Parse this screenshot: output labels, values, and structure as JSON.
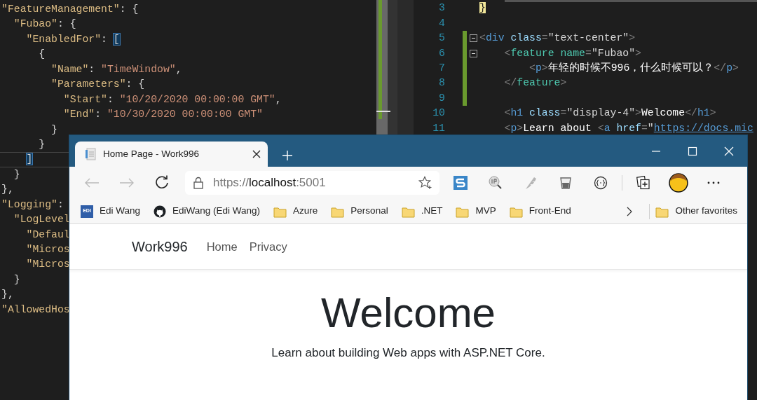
{
  "json_editor": {
    "lines": [
      {
        "current": false,
        "tokens": [
          {
            "text": "\"FeatureManagement\"",
            "kind": "k"
          },
          {
            "text": ": {",
            "kind": "p"
          }
        ]
      },
      {
        "current": false,
        "tokens": [
          {
            "text": "  \"Fubao\"",
            "kind": "k"
          },
          {
            "text": ": {",
            "kind": "p"
          }
        ]
      },
      {
        "current": false,
        "tokens": [
          {
            "text": "    \"EnabledFor\"",
            "kind": "k"
          },
          {
            "text": ": ",
            "kind": "p"
          },
          {
            "text": "[",
            "kind": "b"
          }
        ]
      },
      {
        "current": false,
        "tokens": [
          {
            "text": "      {",
            "kind": "p"
          }
        ]
      },
      {
        "current": false,
        "tokens": [
          {
            "text": "        \"Name\"",
            "kind": "k"
          },
          {
            "text": ": ",
            "kind": "p"
          },
          {
            "text": "\"TimeWindow\"",
            "kind": "s"
          },
          {
            "text": ",",
            "kind": "p"
          }
        ]
      },
      {
        "current": false,
        "tokens": [
          {
            "text": "        \"Parameters\"",
            "kind": "k"
          },
          {
            "text": ": {",
            "kind": "p"
          }
        ]
      },
      {
        "current": false,
        "tokens": [
          {
            "text": "          \"Start\"",
            "kind": "k"
          },
          {
            "text": ": ",
            "kind": "p"
          },
          {
            "text": "\"10/20/2020 00:00:00 GMT\"",
            "kind": "s"
          },
          {
            "text": ",",
            "kind": "p"
          }
        ]
      },
      {
        "current": false,
        "tokens": [
          {
            "text": "          \"End\"",
            "kind": "k"
          },
          {
            "text": ": ",
            "kind": "p"
          },
          {
            "text": "\"10/30/2020 00:00:00 GMT\"",
            "kind": "s"
          }
        ]
      },
      {
        "current": false,
        "tokens": [
          {
            "text": "        }",
            "kind": "p"
          }
        ]
      },
      {
        "current": false,
        "tokens": [
          {
            "text": "      }",
            "kind": "p"
          }
        ]
      },
      {
        "current": true,
        "tokens": [
          {
            "text": "    ]",
            "kind": "b"
          }
        ]
      },
      {
        "current": false,
        "tokens": [
          {
            "text": "  }",
            "kind": "p"
          }
        ]
      },
      {
        "current": false,
        "tokens": [
          {
            "text": "},",
            "kind": "p"
          }
        ]
      },
      {
        "current": false,
        "tokens": [
          {
            "text": "\"Logging\"",
            "kind": "k"
          },
          {
            "text": ":",
            "kind": "p"
          }
        ]
      },
      {
        "current": false,
        "tokens": [
          {
            "text": "  \"LogLevel",
            "kind": "k"
          }
        ]
      },
      {
        "current": false,
        "tokens": [
          {
            "text": "    \"Defaul",
            "kind": "k"
          }
        ]
      },
      {
        "current": false,
        "tokens": [
          {
            "text": "    \"Micros",
            "kind": "k"
          }
        ]
      },
      {
        "current": false,
        "tokens": [
          {
            "text": "    \"Micros",
            "kind": "k"
          }
        ]
      },
      {
        "current": false,
        "tokens": [
          {
            "text": "  }",
            "kind": "p"
          }
        ]
      },
      {
        "current": false,
        "tokens": [
          {
            "text": "},",
            "kind": "p"
          }
        ]
      },
      {
        "current": false,
        "tokens": [
          {
            "text": "\"AllowedHos",
            "kind": "k"
          }
        ]
      }
    ]
  },
  "html_editor": {
    "lines": [
      {
        "number": "3",
        "changed": false,
        "fold": false,
        "tokens": [
          {
            "text": "}",
            "kind": "m"
          }
        ]
      },
      {
        "number": "4",
        "changed": false,
        "fold": false
      },
      {
        "number": "5",
        "changed": true,
        "fold": true,
        "tokens": [
          {
            "text": "<",
            "kind": "d"
          },
          {
            "text": "div",
            "kind": "t"
          },
          {
            "text": " class",
            "kind": "a"
          },
          {
            "text": "=",
            "kind": "d"
          },
          {
            "text": "\"text-center\"",
            "kind": "v"
          },
          {
            "text": ">",
            "kind": "d"
          }
        ]
      },
      {
        "number": "6",
        "changed": true,
        "fold": true,
        "tokens": [
          {
            "text": "    <",
            "kind": "d"
          },
          {
            "text": "feature",
            "kind": "c"
          },
          {
            "text": " name",
            "kind": "c"
          },
          {
            "text": "=",
            "kind": "d"
          },
          {
            "text": "\"Fubao\"",
            "kind": "v"
          },
          {
            "text": ">",
            "kind": "d"
          }
        ]
      },
      {
        "number": "7",
        "changed": true,
        "fold": false,
        "tokens": [
          {
            "text": "        <",
            "kind": "d"
          },
          {
            "text": "p",
            "kind": "t"
          },
          {
            "text": ">",
            "kind": "d"
          },
          {
            "text": "年轻的时候不996，什么时候可以？",
            "kind": "x"
          },
          {
            "text": "</",
            "kind": "d"
          },
          {
            "text": "p",
            "kind": "t"
          },
          {
            "text": ">",
            "kind": "d"
          }
        ]
      },
      {
        "number": "8",
        "changed": true,
        "fold": false,
        "tokens": [
          {
            "text": "    </",
            "kind": "d"
          },
          {
            "text": "feature",
            "kind": "c"
          },
          {
            "text": ">",
            "kind": "d"
          }
        ]
      },
      {
        "number": "9",
        "changed": true,
        "fold": false
      },
      {
        "number": "10",
        "changed": false,
        "fold": false,
        "tokens": [
          {
            "text": "    <",
            "kind": "d"
          },
          {
            "text": "h1",
            "kind": "t"
          },
          {
            "text": " class",
            "kind": "a"
          },
          {
            "text": "=",
            "kind": "d"
          },
          {
            "text": "\"display-4\"",
            "kind": "v"
          },
          {
            "text": ">",
            "kind": "d"
          },
          {
            "text": "Welcome",
            "kind": "x"
          },
          {
            "text": "</",
            "kind": "d"
          },
          {
            "text": "h1",
            "kind": "t"
          },
          {
            "text": ">",
            "kind": "d"
          }
        ]
      },
      {
        "number": "11",
        "changed": false,
        "fold": false,
        "tokens": [
          {
            "text": "    <",
            "kind": "d"
          },
          {
            "text": "p",
            "kind": "t"
          },
          {
            "text": ">",
            "kind": "d"
          },
          {
            "text": "Learn about ",
            "kind": "x"
          },
          {
            "text": "<",
            "kind": "d"
          },
          {
            "text": "a",
            "kind": "t"
          },
          {
            "text": " href",
            "kind": "a"
          },
          {
            "text": "=",
            "kind": "d"
          },
          {
            "text": "\"",
            "kind": "v"
          },
          {
            "text": "https://docs.mic",
            "kind": "u"
          }
        ]
      }
    ]
  },
  "browser": {
    "tab": {
      "title": "Home Page - Work996"
    },
    "address": {
      "scheme": "https://",
      "host": "localhost",
      "port": ":5001"
    },
    "bookmarks": [
      {
        "kind": "site",
        "badge": "EDI",
        "label": "Edi Wang"
      },
      {
        "kind": "github",
        "label": "EdiWang (Edi Wang)"
      },
      {
        "kind": "folder",
        "label": "Azure"
      },
      {
        "kind": "folder",
        "label": "Personal"
      },
      {
        "kind": "folder",
        "label": ".NET"
      },
      {
        "kind": "folder",
        "label": "MVP"
      },
      {
        "kind": "folder",
        "label": "Front-End"
      }
    ],
    "other_favorites": {
      "label": "Other favorites"
    },
    "page": {
      "brand": "Work996",
      "nav": [
        {
          "label": "Home"
        },
        {
          "label": "Privacy"
        }
      ],
      "heading": "Welcome",
      "intro": {
        "before": "Learn about ",
        "link": "building Web apps with ASP.NET Core",
        "after": "."
      }
    }
  }
}
